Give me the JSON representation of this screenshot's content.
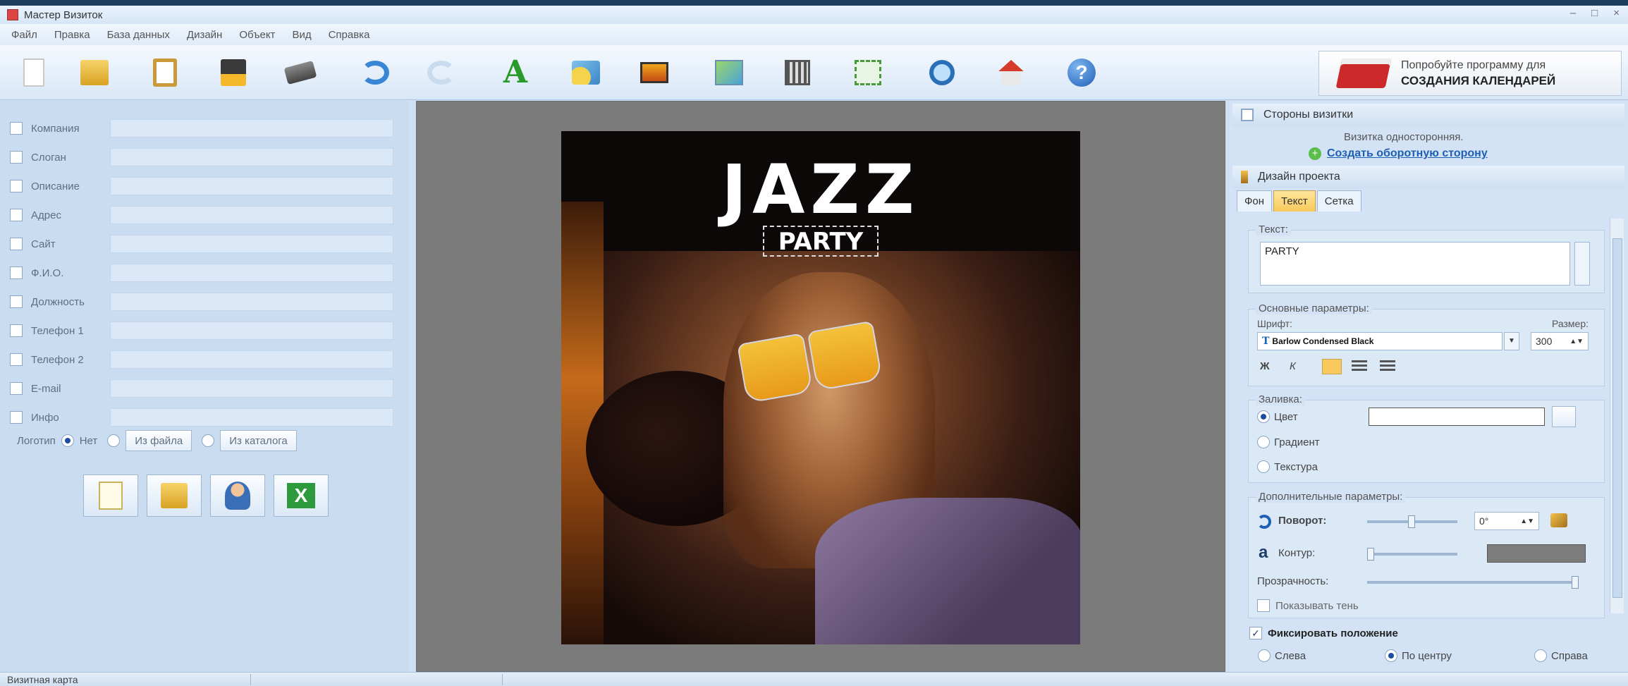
{
  "window": {
    "title": "Мастер Визиток"
  },
  "menu": [
    "Файл",
    "Правка",
    "База данных",
    "Дизайн",
    "Объект",
    "Вид",
    "Справка"
  ],
  "toolbar": {
    "icons": [
      "new-file-icon",
      "open-folder-icon",
      "clipboard-icon",
      "save-icon",
      "print-icon",
      "undo-icon",
      "redo-icon",
      "text-icon",
      "shapes-icon",
      "image-icon",
      "map-icon",
      "qr-code-icon",
      "screenshot-icon",
      "search-zoom-icon",
      "home-icon",
      "help-icon"
    ],
    "promo_line1": "Попробуйте программу для",
    "promo_line2": "СОЗДАНИЯ КАЛЕНДАРЕЙ"
  },
  "fields": [
    {
      "label": "Компания"
    },
    {
      "label": "Слоган"
    },
    {
      "label": "Описание"
    },
    {
      "label": "Адрес"
    },
    {
      "label": "Сайт"
    },
    {
      "label": "Ф.И.О."
    },
    {
      "label": "Должность"
    },
    {
      "label": "Телефон 1"
    },
    {
      "label": "Телефон 2"
    },
    {
      "label": "E-mail"
    },
    {
      "label": "Инфо"
    }
  ],
  "logo": {
    "label": "Логотип",
    "option_none": "Нет",
    "option_file": "Из файла",
    "option_catalog": "Из каталога"
  },
  "card": {
    "title": "JAZZ",
    "subtitle": "PARTY"
  },
  "right": {
    "sides_title": "Стороны визитки",
    "sides_info": "Визитка односторонняя.",
    "create_back_link": "Создать оборотную сторону",
    "design_title": "Дизайн проекта",
    "tabs": [
      "Фон",
      "Текст",
      "Сетка"
    ],
    "text_group": "Текст:",
    "text_value": "PARTY",
    "basic_group": "Основные параметры:",
    "font_label": "Шрифт:",
    "size_label": "Размер:",
    "font_value": "Barlow Condensed Black",
    "size_value": "300",
    "bold_label": "Ж",
    "italic_label": "К",
    "fill_group": "Заливка:",
    "fill_color": "Цвет",
    "fill_gradient": "Градиент",
    "fill_texture": "Текстура",
    "extra_group": "Дополнительные параметры:",
    "rotation_label": "Поворот:",
    "rotation_value": "0°",
    "contour_label": "Контур:",
    "transparency_label": "Прозрачность:",
    "shadow_label": "Показывать тень",
    "fix_label": "Фиксировать положение",
    "align_left": "Слева",
    "align_center": "По центру",
    "align_right": "Справа"
  },
  "status": {
    "text": "Визитная карта"
  }
}
